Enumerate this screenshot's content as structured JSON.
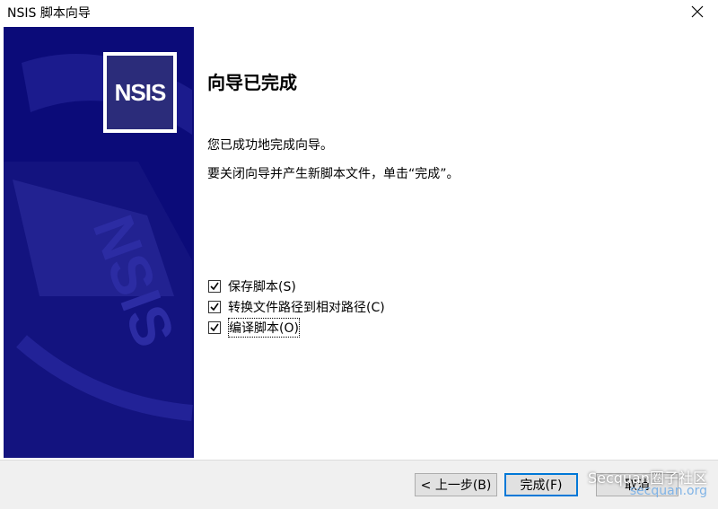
{
  "window": {
    "title": "NSIS 脚本向导"
  },
  "sidebar": {
    "logo_text": "NSIS",
    "watermark_text": "NSIS"
  },
  "main": {
    "heading": "向导已完成",
    "line1": "您已成功地完成向导。",
    "line2": "要关闭向导并产生新脚本文件，单击“完成”。",
    "options": [
      {
        "label": "保存脚本(S)",
        "checked": true
      },
      {
        "label": "转换文件路径到相对路径(C)",
        "checked": true
      },
      {
        "label": "编译脚本(O)",
        "checked": true
      }
    ]
  },
  "footer": {
    "back_label": "< 上一步(B)",
    "finish_label": "完成(F)",
    "cancel_label": "取消"
  },
  "watermark": {
    "brand": "Secquan圈子社区",
    "url": "secquan.org"
  }
}
